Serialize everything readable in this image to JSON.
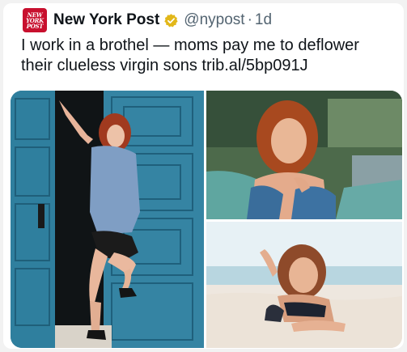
{
  "tweet": {
    "logo_text": [
      "NEW",
      "YORK",
      "POST"
    ],
    "display_name": "New York Post",
    "handle": "@nypost",
    "separator": "·",
    "time": "1d",
    "text": "I work in a brothel — moms pay me to deflower their clueless virgin sons trib.al/5bp091J"
  },
  "icons": {
    "verified": "verified-badge-icon"
  },
  "colors": {
    "brand_red": "#c8102e",
    "verified_gold": "#e2b719",
    "door_teal": "#2f7f9e",
    "text_primary": "#0f1419",
    "text_secondary": "#536471"
  }
}
